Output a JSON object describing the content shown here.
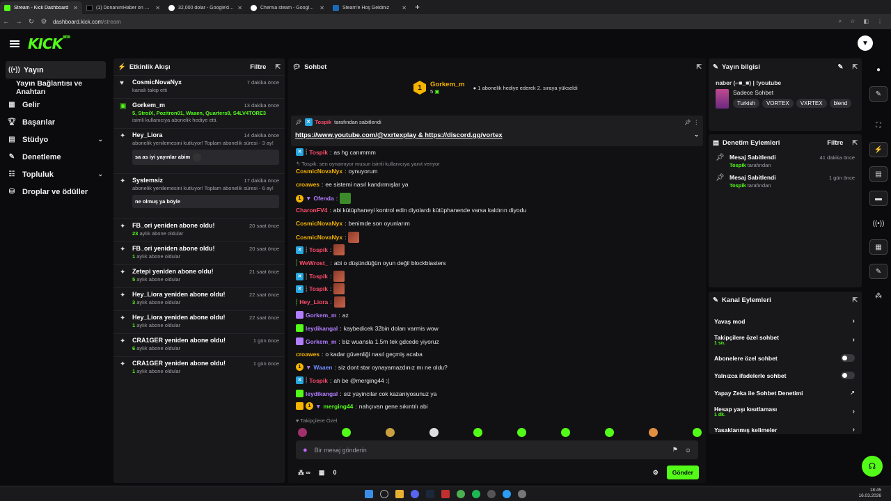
{
  "browser": {
    "tabs": [
      {
        "title": "Stream - Kick Dashboard",
        "color": "#53fc18"
      },
      {
        "title": "(1) DonanımHaber on X: \"⚠️ Stea",
        "color": "#000000"
      },
      {
        "title": "32,000 dolar - Google'da Ara",
        "color": "#4285f4"
      },
      {
        "title": "Chemia steam - Google'da Ara",
        "color": "#4285f4"
      },
      {
        "title": "Steam'e Hoş Geldiniz",
        "color": "#1b6ab8"
      }
    ],
    "url_host": "dashboard.kick.com",
    "url_path": "/stream"
  },
  "brand": {
    "logo": "KICK",
    "beta": "BETA"
  },
  "sidebar": {
    "items": [
      {
        "label": "Yayın",
        "icon": "broadcast-icon"
      },
      {
        "label": "Yayın Bağlantısı ve Anahtarı"
      },
      {
        "label": "Gelir",
        "icon": "revenue-icon"
      },
      {
        "label": "Başarılar",
        "icon": "trophy-icon"
      },
      {
        "label": "Stüdyo",
        "icon": "studio-icon"
      },
      {
        "label": "Denetleme",
        "icon": "wrench-icon"
      },
      {
        "label": "Topluluk",
        "icon": "community-icon"
      },
      {
        "label": "Droplar ve ödüller",
        "icon": "drops-icon"
      }
    ]
  },
  "activity": {
    "title": "Etkinlik Akışı",
    "filter": "Filtre",
    "items": [
      {
        "name": "CosmicNovaNyx",
        "time": "7 dakika önce",
        "sub": "kanalı takip etti"
      },
      {
        "name": "Gorkem_m",
        "time": "13 dakika önce",
        "gift_names": "5, StroiX, Pozitron01, Waaen, Quarters8, S4LV4TORE3",
        "sub": "isimli kullanıcıya abonelik hediye etti."
      },
      {
        "name": "Hey_Liora",
        "time": "14 dakika önce",
        "sub": "abonelik yenilemesini kutluyor! Toplam abonelik süresi - 3 ay!",
        "quote": "sa as iyi yayınlar abim"
      },
      {
        "name": "Systemsiz",
        "time": "17 dakika önce",
        "sub": "abonelik yenilemesini kutluyor! Toplam abonelik süresi - 6 ay!",
        "quote": "ne olmuş ya böyle"
      },
      {
        "name": "FB_ori yeniden abone oldu!",
        "time": "20 saat önce",
        "count": "23",
        "sub": "aylık abone oldular"
      },
      {
        "name": "FB_ori yeniden abone oldu!",
        "time": "20 saat önce",
        "count": "1",
        "sub": "aylık abone oldular"
      },
      {
        "name": "Zetepi yeniden abone oldu!",
        "time": "21 saat önce",
        "count": "5",
        "sub": "aylık abone oldular"
      },
      {
        "name": "Hey_Liora yeniden abone oldu!",
        "time": "22 saat önce",
        "count": "3",
        "sub": "aylık abone oldular"
      },
      {
        "name": "Hey_Liora yeniden abone oldu!",
        "time": "22 saat önce",
        "count": "1",
        "sub": "aylık abone oldular"
      },
      {
        "name": "CRA1GER yeniden abone oldu!",
        "time": "1 gün önce",
        "count": "6",
        "sub": "aylık abone oldular"
      },
      {
        "name": "CRA1GER yeniden abone oldu!",
        "time": "1 gün önce",
        "count": "1",
        "sub": "aylık abone oldular"
      }
    ]
  },
  "chat": {
    "title": "Sohbet",
    "hero_name": "Gorkem_m",
    "hero_count": "5",
    "hero_text": "1 abonelik hediye ederek 2. sıraya yükseldi",
    "hero_rank": "1",
    "pinned_by_user": "Tospik",
    "pinned_by_text": "tarafından sabitlendi",
    "pinned_link1": "https://www.youtube.com/@vxrtexplay",
    "pinned_amp": "&",
    "pinned_link2": "https://discord.gg/vortex",
    "reply_text": "Tospik: sen oynamıyor musun isimli kullanıcıya yanıt veriyor",
    "messages": [
      {
        "user": "Tospik",
        "color": "#ff4d6d",
        "text": "as hg canımmm"
      },
      {
        "user": "CosmicNovaNyx",
        "color": "#f5b400",
        "text": "oynuyorum"
      },
      {
        "user": "croawes",
        "color": "#f5b400",
        "text": "ee sistemi nasıl kandırmışlar ya"
      },
      {
        "user": "Ofenda",
        "color": "#b37dff",
        "text": ""
      },
      {
        "user": "CharonFV4",
        "color": "#ff4d6d",
        "text": "abi kütüphaneyi kontrol edin diyolardı kütüphanende varsa kaldırın diyodu"
      },
      {
        "user": "CosmicNovaNyx",
        "color": "#f5b400",
        "text": "benimde son oyunlarım"
      },
      {
        "user": "CosmicNovaNyx",
        "color": "#f5b400",
        "text": ""
      },
      {
        "user": "Tospik",
        "color": "#ff4d6d",
        "text": ""
      },
      {
        "user": "WeWrost_",
        "color": "#ff4d6d",
        "text": "abi o düşündüğün oyun değil blockblasters"
      },
      {
        "user": "Tospik",
        "color": "#ff4d6d",
        "text": ""
      },
      {
        "user": "Tospik",
        "color": "#ff4d6d",
        "text": ""
      },
      {
        "user": "Hey_Liora",
        "color": "#ff4d6d",
        "text": ""
      },
      {
        "user": "Gorkem_m",
        "color": "#b37dff",
        "text": "az"
      },
      {
        "user": "leydikangal",
        "color": "#b37dff",
        "text": "kaybedicek 32bin doları varmis wow"
      },
      {
        "user": "Gorkem_m",
        "color": "#b37dff",
        "text": "biz wuansla 1.5m tek gdcede yiyoruz"
      },
      {
        "user": "croawes",
        "color": "#f5b400",
        "text": "o kadar güvenliği nasıl geçmiş acaba"
      },
      {
        "user": "Waaen",
        "color": "#6f8cff",
        "text": "siz dont star oynayamazdınız mı ne oldu?"
      },
      {
        "user": "Tospik",
        "color": "#ff4d6d",
        "text": "ah be @merging44 :("
      },
      {
        "user": "leydikangal",
        "color": "#b37dff",
        "text": "siz yayincilar cok kazaniyosunuz ya"
      },
      {
        "user": "merging44",
        "color": "#53fc18",
        "text": "nahçıvan gene sıkıntılı abi"
      }
    ],
    "followers_only": "Takipçilere Özel",
    "placeholder": "Bir mesaj gönderin",
    "footer_count": "0",
    "send_label": "Gönder"
  },
  "stream_info": {
    "title": "Yayın bilgisi",
    "stream_title": "naber (⌐■_■) | !youtube",
    "category": "Sadece Sohbet",
    "tags": [
      "Turkish",
      "VORTEX",
      "VXRTEX",
      "blend"
    ]
  },
  "moderation": {
    "title": "Denetim Eylemleri",
    "filter": "Filtre",
    "items": [
      {
        "action": "Mesaj Sabitlendi",
        "time": "41 dakika önce",
        "user": "Tospik",
        "suffix": "tarafından"
      },
      {
        "action": "Mesaj Sabitlendi",
        "time": "1 gün önce",
        "user": "Tospik",
        "suffix": "tarafından"
      }
    ]
  },
  "channel_actions": {
    "title": "Kanal Eylemleri",
    "items": [
      {
        "label": "Yavaş mod"
      },
      {
        "label": "Takipçilere özel sohbet",
        "sub": "1 sn."
      },
      {
        "label": "Abonelere özel sohbet"
      },
      {
        "label": "Yalnızca ifadelerle sohbet"
      },
      {
        "label": "Yapay Zeka ile Sohbet Denetimi"
      },
      {
        "label": "Hesap yaşı kısıtlaması",
        "sub": "1 dk."
      },
      {
        "label": "Yasaklanmış kelimeler"
      }
    ]
  },
  "clock": {
    "time": "18:45",
    "date": "16.03.2026"
  },
  "colors": {
    "accent": "#53fc18",
    "gold": "#f5b400"
  }
}
